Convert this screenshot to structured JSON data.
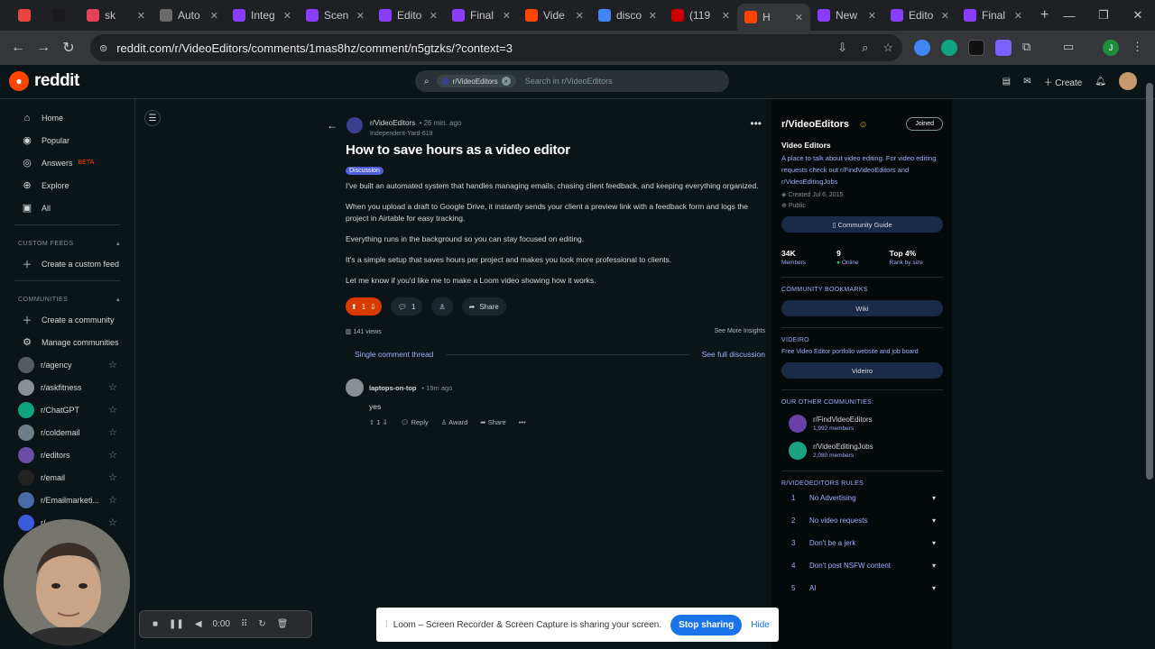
{
  "browser": {
    "tabs": [
      {
        "title": "",
        "color": "#e8453c"
      },
      {
        "title": "",
        "color": "#1a1a1a"
      },
      {
        "title": "sk",
        "color": "#e2445c"
      },
      {
        "title": "Auto",
        "color": "#6b6b6b"
      },
      {
        "title": "Integ",
        "color": "#8b3dff"
      },
      {
        "title": "Scen",
        "color": "#8b3dff"
      },
      {
        "title": "Edito",
        "color": "#8b3dff"
      },
      {
        "title": "Final",
        "color": "#8b3dff"
      },
      {
        "title": "Vide",
        "color": "#ff4500"
      },
      {
        "title": "disco",
        "color": "#4285f4"
      },
      {
        "title": "(119",
        "color": "#cc0000"
      },
      {
        "title": "H",
        "color": "#ff4500"
      },
      {
        "title": "New",
        "color": "#8b3dff"
      },
      {
        "title": "Edito",
        "color": "#8b3dff"
      },
      {
        "title": "Final",
        "color": "#8b3dff"
      }
    ],
    "url": "reddit.com/r/VideoEditors/comments/1mas8hz/comment/n5gtzks/?context=3"
  },
  "header": {
    "logo_text": "reddit",
    "search_chip": "r/VideoEditors",
    "search_placeholder": "Search in r/VideoEditors",
    "create_label": "Create"
  },
  "sidebar": {
    "nav": [
      {
        "label": "Home",
        "icon": "⌂"
      },
      {
        "label": "Popular",
        "icon": "◉"
      },
      {
        "label": "Answers",
        "icon": "◎",
        "badge": "BETA"
      },
      {
        "label": "Explore",
        "icon": "⊕"
      },
      {
        "label": "All",
        "icon": "▣"
      }
    ],
    "custom_feeds_title": "CUSTOM FEEDS",
    "create_feed": "Create a custom feed",
    "communities_title": "COMMUNITIES",
    "create_community": "Create a community",
    "manage_communities": "Manage communities",
    "communities": [
      {
        "label": "r/agency",
        "color": "#555a5e"
      },
      {
        "label": "r/askfitness",
        "color": "#8a8f93"
      },
      {
        "label": "r/ChatGPT",
        "color": "#10a37f"
      },
      {
        "label": "r/coldemail",
        "color": "#6f7f89"
      },
      {
        "label": "r/editors",
        "color": "#6a4ea8"
      },
      {
        "label": "r/email",
        "color": "#222"
      },
      {
        "label": "r/Emailmarketi...",
        "color": "#4a6aa8"
      },
      {
        "label": "r/",
        "color": "#3b5bdb"
      }
    ]
  },
  "post": {
    "subreddit": "r/VideoEditors",
    "time": "• 26 min. ago",
    "author": "Independent-Yard-619",
    "title": "How to save hours as a video editor",
    "flair": "Discussion",
    "paragraphs": [
      "I've built an automated system that handles managing emails, chasing client feedback, and keeping everything organized.",
      "When you upload a draft to Google Drive, it instantly sends your client a preview link with a feedback form and logs the project in Airtable for easy tracking.",
      "Everything runs in the background so you can stay focused on editing.",
      "It's a simple setup that saves hours per project and makes you look more professional to clients.",
      "Let me know if you'd like me to make a Loom video showing how it works."
    ],
    "votes": "1",
    "comments": "1",
    "share": "Share",
    "views": "141 views",
    "insights": "See More Insights",
    "single_thread": "Single comment thread",
    "full_discussion": "See full discussion"
  },
  "comment": {
    "author": "laptops-on-top",
    "time": "• 19m ago",
    "text": "yes",
    "votes": "1",
    "reply": "Reply",
    "award": "Award",
    "share": "Share"
  },
  "rail": {
    "name": "r/VideoEditors",
    "joined": "Joined",
    "subtitle": "Video Editors",
    "description": "A place to talk about video editing. For video editing requests check out r/FindVideoEditors and r/VideoEditingJobs",
    "created": "Created Jul 6, 2015",
    "visibility": "Public",
    "guide": "Community Guide",
    "stats": [
      {
        "value": "34K",
        "label": "Members"
      },
      {
        "value": "9",
        "label": "Online"
      },
      {
        "value": "Top 4%",
        "label": "Rank by size"
      }
    ],
    "bookmarks_title": "COMMUNITY BOOKMARKS",
    "wiki": "Wiki",
    "videiro_title": "VIDEIRO",
    "videiro_text": "Free Video Editor portfolio website and job board",
    "videiro_btn": "Videiro",
    "other_title": "OUR OTHER COMMUNITIES:",
    "others": [
      {
        "name": "r/FindVideoEditors",
        "members": "1,992 members",
        "color": "#6a3fa8"
      },
      {
        "name": "r/VideoEditingJobs",
        "members": "2,080 members",
        "color": "#1aa37f"
      }
    ],
    "rules_title": "R/VIDEOEDITORS RULES",
    "rules": [
      {
        "num": "1",
        "text": "No Advertising"
      },
      {
        "num": "2",
        "text": "No video requests"
      },
      {
        "num": "3",
        "text": "Don't be a jerk"
      },
      {
        "num": "4",
        "text": "Don't post NSFW content"
      },
      {
        "num": "5",
        "text": "AI"
      }
    ]
  },
  "loom": {
    "message": "Loom – Screen Recorder & Screen Capture is sharing your screen.",
    "stop": "Stop sharing",
    "hide": "Hide",
    "timer": "0:00"
  }
}
